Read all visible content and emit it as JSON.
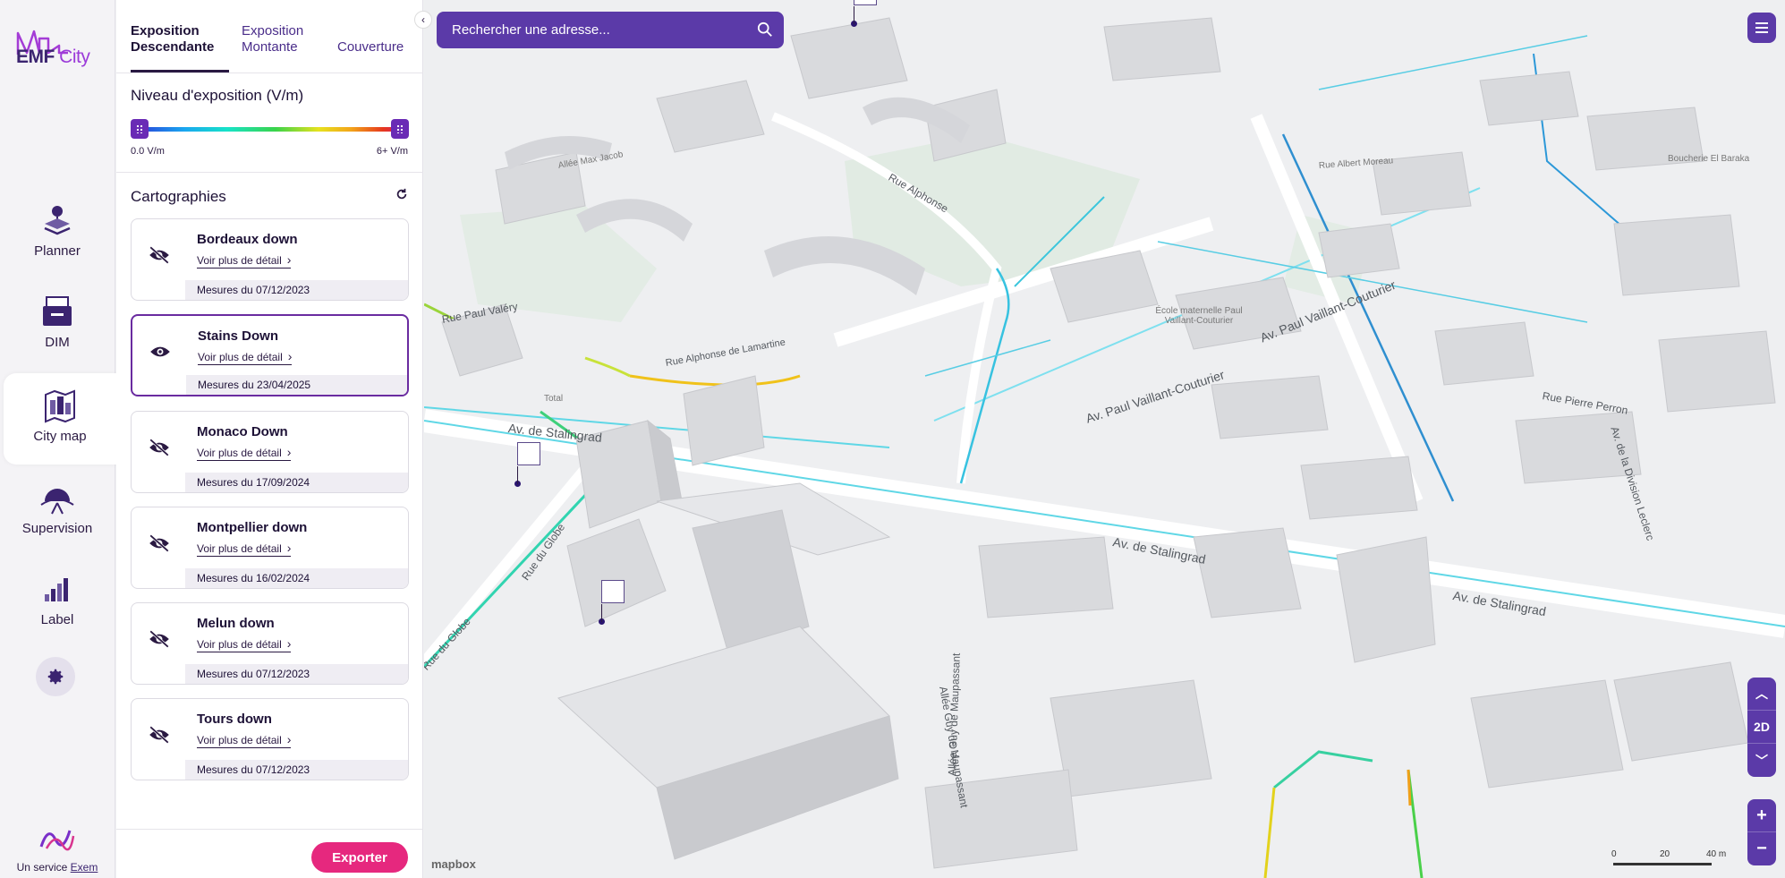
{
  "brand": {
    "name_emf": "EMF",
    "name_city": "City",
    "footer_text": "Un service",
    "footer_link": "Exem"
  },
  "nav": [
    {
      "id": "planner",
      "label": "Planner",
      "icon": "layers-pin-icon"
    },
    {
      "id": "dim",
      "label": "DIM",
      "icon": "folder-tray-icon"
    },
    {
      "id": "citymap",
      "label": "City map",
      "icon": "city-map-icon",
      "active": true
    },
    {
      "id": "supervision",
      "label": "Supervision",
      "icon": "antenna-dome-icon"
    },
    {
      "id": "label",
      "label": "Label",
      "icon": "bar-chart-icon"
    }
  ],
  "tabs": [
    {
      "line1": "Exposition",
      "line2": "Descendante",
      "active": true
    },
    {
      "line1": "Exposition",
      "line2": "Montante",
      "active": false
    },
    {
      "line1": "Couverture",
      "line2": "",
      "active": false
    }
  ],
  "exposure": {
    "title": "Niveau d'exposition (V/m)",
    "min_label": "0.0 V/m",
    "max_label": "6+ V/m",
    "range_low": 0,
    "range_high": 1
  },
  "cartographies": {
    "title": "Cartographies",
    "link_label": "Voir plus de détail",
    "items": [
      {
        "name": "Bordeaux down",
        "date": "Mesures du 07/12/2023",
        "visible": false,
        "active": false
      },
      {
        "name": "Stains Down",
        "date": "Mesures du 23/04/2025",
        "visible": true,
        "active": true
      },
      {
        "name": "Monaco Down",
        "date": "Mesures du 17/09/2024",
        "visible": false,
        "active": false
      },
      {
        "name": "Montpellier down",
        "date": "Mesures du 16/02/2024",
        "visible": false,
        "active": false
      },
      {
        "name": "Melun down",
        "date": "Mesures du 07/12/2023",
        "visible": false,
        "active": false
      },
      {
        "name": "Tours down",
        "date": "Mesures du 07/12/2023",
        "visible": false,
        "active": false
      }
    ]
  },
  "export_label": "Exporter",
  "search": {
    "placeholder": "Rechercher une adresse..."
  },
  "map": {
    "view_mode": "2D",
    "zoom_in": "+",
    "zoom_out": "−",
    "attribution": "mapbox",
    "scale": {
      "zero": "0",
      "mid": "20",
      "end": "40 m"
    },
    "labels": [
      "Av. de Stalingrad",
      "Av. de Stalingrad",
      "Av. de Stalingrad",
      "Av. Paul Vaillant-Couturier",
      "Av. Paul Vaillant-Couturier",
      "Rue du Globe",
      "Rue du Globe",
      "Allée Guy de Maupassant",
      "Allée Guy de Maupassant",
      "Rue Alphonse de Lamartine",
      "Rue Alphonse",
      "Av. de la Division Leclerc",
      "Rue Pierre Perron",
      "Rue Paul Valéry",
      "Allée Max Jacob",
      "Rue Albert Moreau",
      "École maternelle Paul Vaillant-Couturier",
      "Total",
      "Boucherie El Baraka"
    ]
  },
  "colors": {
    "accent": "#5b3aa8",
    "export": "#e6287e",
    "active_border": "#6a2ba0"
  }
}
